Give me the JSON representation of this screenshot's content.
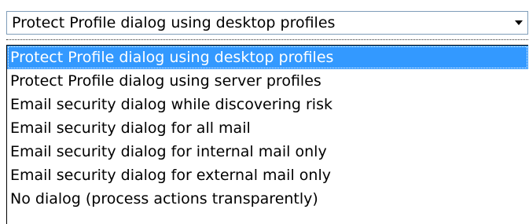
{
  "combo": {
    "selected_value": "Protect Profile dialog using desktop profiles",
    "arrow_icon": "chevron-down-icon"
  },
  "dropdown": {
    "options": [
      {
        "label": "Protect Profile dialog using desktop profiles",
        "selected": true
      },
      {
        "label": "Protect Profile dialog using server profiles",
        "selected": false
      },
      {
        "label": "Email security dialog while discovering risk",
        "selected": false
      },
      {
        "label": "Email security dialog for all mail",
        "selected": false
      },
      {
        "label": "Email security dialog for internal mail only",
        "selected": false
      },
      {
        "label": "Email security dialog for external mail only",
        "selected": false
      },
      {
        "label": "No dialog (process actions transparently)",
        "selected": false
      }
    ]
  },
  "colors": {
    "selection": "#3399ff",
    "selection_text": "#ffffff",
    "border": "#7f9db9"
  }
}
